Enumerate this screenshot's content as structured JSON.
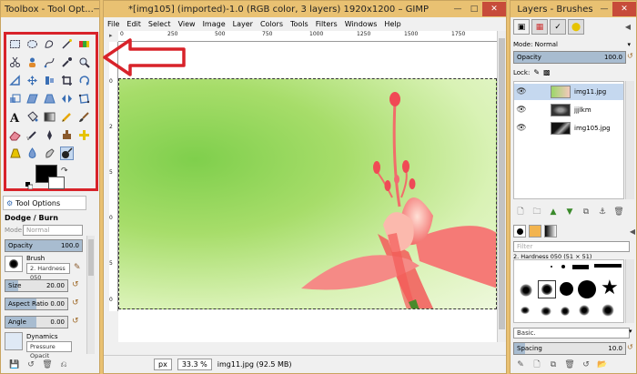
{
  "toolbox": {
    "title": "Toolbox - Tool Opt...",
    "tab_label": "Tool Options",
    "tool_name": "Dodge / Burn",
    "mode_label": "Mode",
    "mode_value": "Normal",
    "opacity_label": "Opacity",
    "opacity_value": "100.0",
    "opacity_level": 1.0,
    "brush_label": "Brush",
    "brush_value": "2. Hardness 050",
    "size_label": "Size",
    "size_value": "20.00",
    "size_level": 0.2,
    "aspect_label": "Aspect Ratio",
    "aspect_value": "0.00",
    "aspect_level": 0.5,
    "angle_label": "Angle",
    "angle_value": "0.00",
    "angle_level": 0.5,
    "dynamics_label": "Dynamics",
    "dynamics_value": "Pressure Opacit"
  },
  "main": {
    "title": "*[img105] (imported)-1.0 (RGB color, 3 layers) 1920x1200 – GIMP",
    "menu": [
      "File",
      "Edit",
      "Select",
      "View",
      "Image",
      "Layer",
      "Colors",
      "Tools",
      "Filters",
      "Windows",
      "Help"
    ],
    "ruler_labels": [
      "0",
      "250",
      "500",
      "750",
      "1000",
      "1250",
      "1500",
      "1750"
    ],
    "ruler_v_labels": [
      "0",
      "2",
      "5",
      "0",
      "5",
      "0"
    ],
    "unit": "px",
    "zoom": "33.3 %",
    "status": "img11.jpg (92.5 MB)"
  },
  "layers": {
    "title": "Layers - Brushes",
    "mode_label": "Mode:",
    "mode_value": "Normal",
    "opacity_label": "Opacity",
    "opacity_value": "100.0",
    "opacity_level": 1.0,
    "lock_label": "Lock:",
    "items": [
      {
        "name": "img11.jpg"
      },
      {
        "name": "jjjlkm"
      },
      {
        "name": "img105.jpg"
      }
    ],
    "filter_placeholder": "Filter",
    "brush_name": "2. Hardness 050 (51 × 51)",
    "preset_value": "Basic.",
    "spacing_label": "Spacing",
    "spacing_value": "10.0",
    "spacing_level": 0.1
  },
  "colors": {
    "titlebar": "#e9c172",
    "annotation": "#d8232a",
    "slider_fill": "#a8bcd0"
  }
}
